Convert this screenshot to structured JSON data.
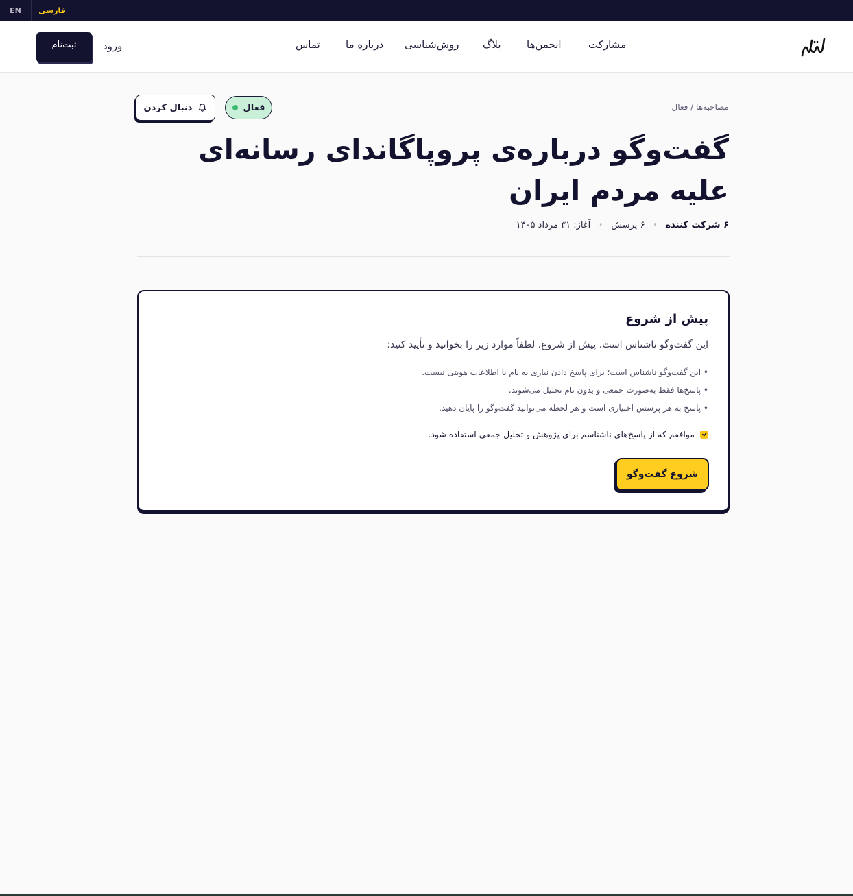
{
  "lang": {
    "en": "EN",
    "fa": "فارسی"
  },
  "nav": {
    "items": [
      "مشارکت",
      "انجمن‌ها",
      "بلاگ",
      "روش‌شناسی",
      "درباره ما",
      "تماس"
    ],
    "login": "ورود",
    "signup": "ثبت‌نام",
    "logo": "شهرا"
  },
  "page": {
    "breadcrumb": "مصاحبه‌ها / فعال",
    "status": "فعال",
    "follow": "دنبال کردن",
    "title": "گفت‌وگو درباره‌ی پروپاگاندای رسانه‌ای علیه مردم ایران",
    "meta": {
      "participants": "۶ شرکت کننده",
      "questions": "۶ پرسش",
      "start": "آغاز: ۳۱ مرداد ۱۴۰۵"
    }
  },
  "card": {
    "title": "پیش از شروع",
    "intro": "این گفت‌وگو ناشناس است. پیش از شروع، لطفاً موارد زیر را بخوانید و تأیید کنید:",
    "bullets": [
      "• این گفت‌وگو ناشناس است؛ برای پاسخ دادن نیازی به نام یا اطلاعات هویتی نیست.",
      "• پاسخ‌ها فقط به‌صورت جمعی و بدون نام تحلیل می‌شوند.",
      "• پاسخ به هر پرسش اختیاری است و هر لحظه می‌توانید گفت‌وگو را پایان دهید."
    ],
    "consent": "موافقم که از پاسخ‌های ناشناسم برای پژوهش و تحلیل جمعی استفاده شود.",
    "consent_checked": true,
    "start_button": "شروع گفت‌وگو"
  },
  "colors": {
    "navy": "#14132f",
    "accent": "#ffcd1f",
    "status_bg": "#c9efd9",
    "status_dot": "#3cba6f"
  }
}
